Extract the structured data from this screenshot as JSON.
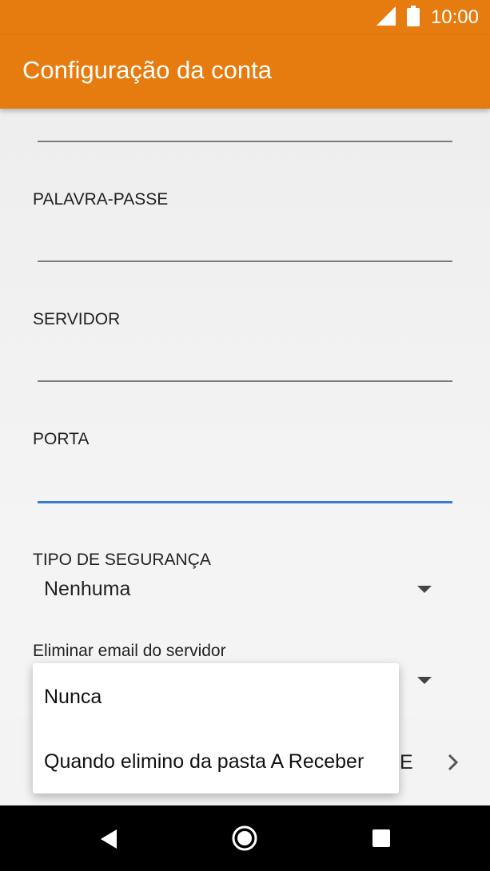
{
  "status": {
    "time": "10:00",
    "signal_icon": "signal-icon",
    "battery_icon": "battery-icon"
  },
  "appbar": {
    "title": "Configuração da conta"
  },
  "form": {
    "password_label": "PALAVRA-PASSE",
    "password_value": "",
    "server_label": "SERVIDOR",
    "server_value": "",
    "port_label": "PORTA",
    "port_value": "",
    "security_label": "TIPO DE SEGURANÇA",
    "security_value": "Nenhuma",
    "delete_label": "Eliminar email do servidor"
  },
  "dropdown": {
    "options": [
      "Nunca",
      "Quando elimino da pasta A Receber"
    ]
  },
  "hidden_row": {
    "suffix_text": "E"
  },
  "colors": {
    "accent": "#e67c0f",
    "focus": "#3c78d8",
    "navbar": "#000000"
  },
  "navbar": {
    "back_icon": "back-icon",
    "home_icon": "home-icon",
    "recents_icon": "recents-icon"
  }
}
